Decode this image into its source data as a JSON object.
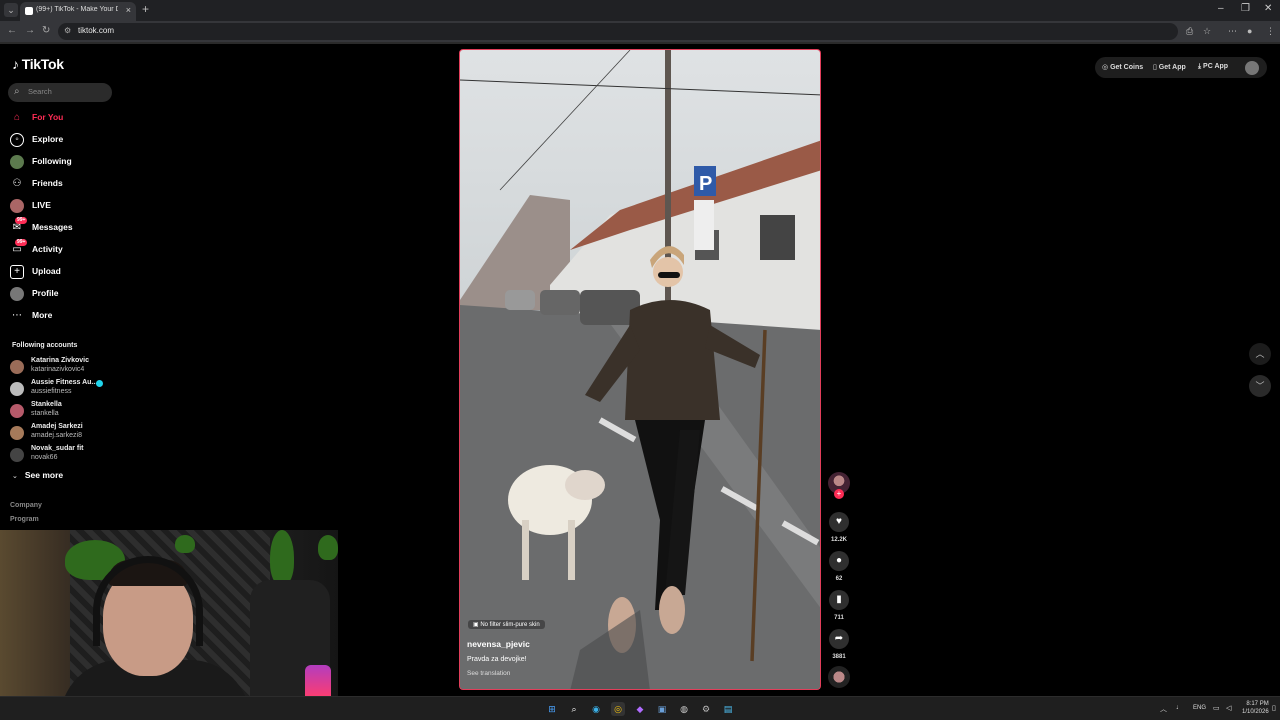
{
  "browser": {
    "tab_title": "(99+) TikTok - Make Your D",
    "url": "tiktok.com",
    "new_tab": "+",
    "tab_close": "×"
  },
  "sidebar": {
    "logo": "TikTok",
    "search_placeholder": "Search",
    "nav": [
      {
        "label": "For You",
        "icon": "home-icon",
        "active": true
      },
      {
        "label": "Explore",
        "icon": "compass-icon"
      },
      {
        "label": "Following",
        "icon": "following-avatar-icon"
      },
      {
        "label": "Friends",
        "icon": "friends-icon"
      },
      {
        "label": "LIVE",
        "icon": "live-icon"
      },
      {
        "label": "Messages",
        "icon": "messages-icon",
        "badge": "99+"
      },
      {
        "label": "Activity",
        "icon": "activity-icon",
        "badge": "99+"
      },
      {
        "label": "Upload",
        "icon": "upload-icon"
      },
      {
        "label": "Profile",
        "icon": "profile-icon"
      },
      {
        "label": "More",
        "icon": "more-icon"
      }
    ],
    "following_title": "Following accounts",
    "accounts": [
      {
        "name": "Katarina Zivkovic",
        "handle": "katarinazivkovic4"
      },
      {
        "name": "Aussie Fitness Au...",
        "handle": "aussiefitness"
      },
      {
        "name": "Stankella",
        "handle": "stankella"
      },
      {
        "name": "Amadej Sarkezi",
        "handle": "amadej.sarkezi8"
      },
      {
        "name": "Novak_sudar fit",
        "handle": "novak66"
      }
    ],
    "see_more": "See more",
    "footer": [
      "Company",
      "Program"
    ]
  },
  "video": {
    "tag": "No filter slim-pure skin",
    "author": "nevensa_pjevic",
    "description": "Pravda za devojke!",
    "see_translation": "See translation"
  },
  "actions": {
    "likes": "12.2K",
    "comments": "62",
    "saves": "711",
    "shares": "3881"
  },
  "top_actions": {
    "coins": "Get Coins",
    "app": "Get App",
    "pc_app": "PC App"
  },
  "taskbar": {
    "lang": "ENG",
    "time": "8:17 PM",
    "date": "1/10/2026"
  },
  "colors": {
    "accent": "#fe2c55",
    "video_border": "#e23e5a"
  }
}
